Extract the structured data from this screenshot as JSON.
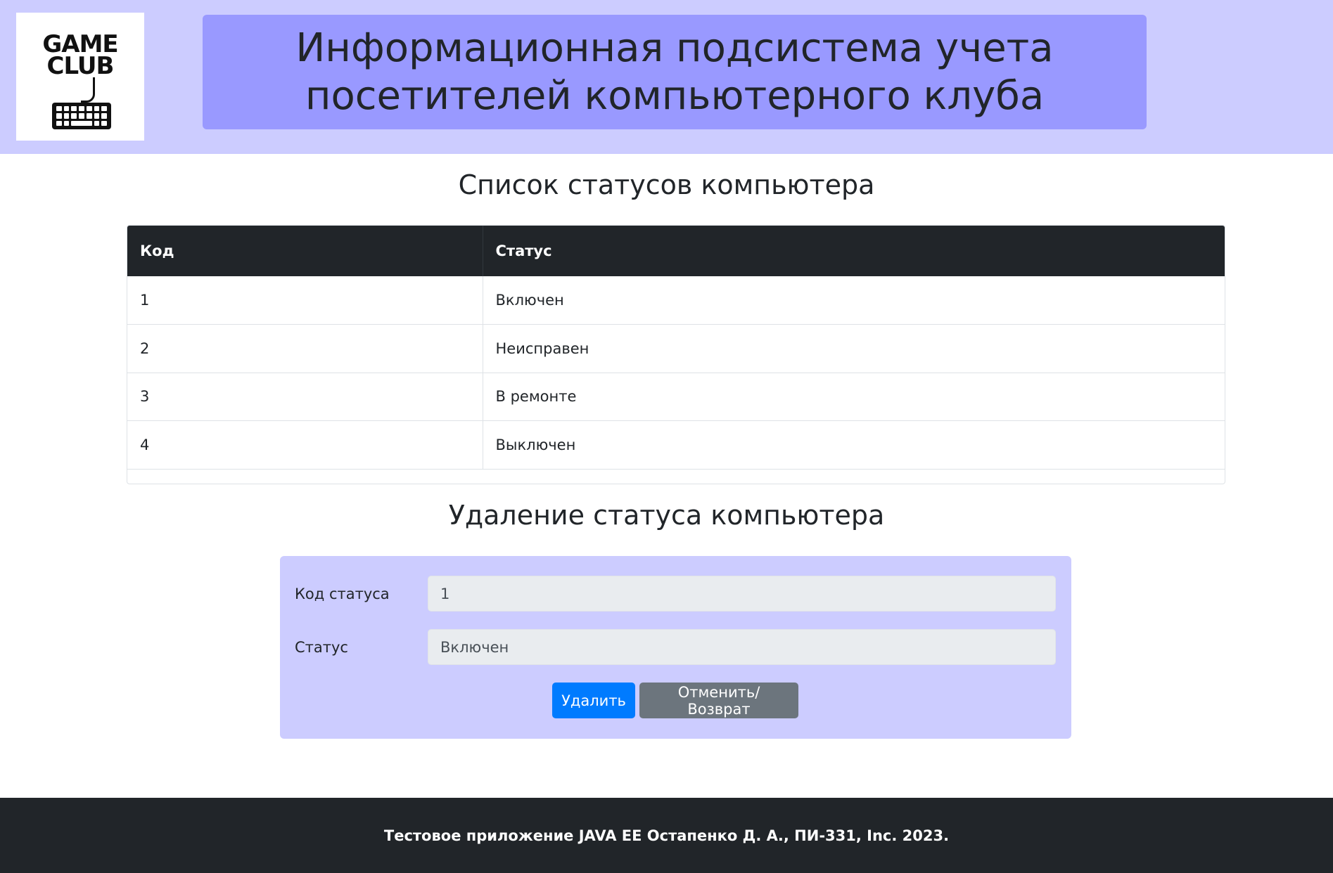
{
  "header": {
    "logo": {
      "line1": "GAME",
      "line2": "CLUB",
      "icon": "keyboard-icon"
    },
    "title": "Информационная подсистема учета посетителей компьютерного клуба"
  },
  "table_section": {
    "title": "Список статусов компьютера",
    "columns": [
      "Код",
      "Статус"
    ],
    "rows": [
      [
        "1",
        "Включен"
      ],
      [
        "2",
        "Неисправен"
      ],
      [
        "3",
        "В ремонте"
      ],
      [
        "4",
        "Выключен"
      ]
    ]
  },
  "form_section": {
    "title": "Удаление статуса компьютера",
    "code_label": "Код статуса",
    "code_value": "1",
    "status_label": "Статус",
    "status_value": "Включен",
    "delete_label": "Удалить",
    "cancel_label": "Отменить/Возврат"
  },
  "footer": {
    "text": "Тестовое приложение JAVA EE Остапенко Д. А., ПИ-331, Inc. 2023."
  },
  "colors": {
    "header_bg": "#ccccff",
    "title_bg": "#9999ff",
    "dark": "#212529",
    "primary": "#007bff",
    "secondary": "#6c757d"
  }
}
